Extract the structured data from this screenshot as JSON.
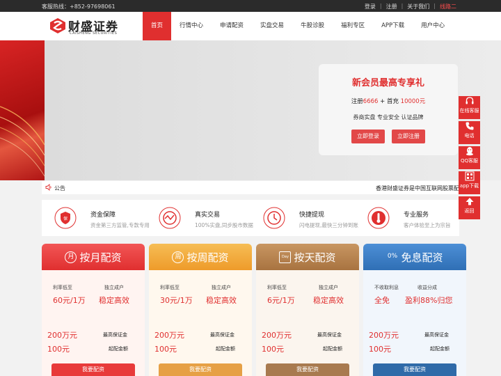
{
  "topbar": {
    "hotline": "客服热线：+852-97698061",
    "links": [
      "登录",
      "注册",
      "关于我们"
    ],
    "route": "线路二"
  },
  "logo": {
    "cn": "财盛证券",
    "en": "CAISHENG SECURITIES"
  },
  "nav": [
    "首页",
    "行情中心",
    "申请配资",
    "实盘交易",
    "牛股诊股",
    "福利专区",
    "APP下载",
    "用户中心"
  ],
  "promo": {
    "title": "新会员最高专享礼",
    "reg_prefix": "注册",
    "reg_amount": "6666",
    "plus": " + 首充 ",
    "charge_amount": "10000元",
    "tagline": "券商实盘 专业安全 认证品牌",
    "login": "立即登录",
    "register": "立即注册"
  },
  "notice": {
    "label": "公告",
    "text": "香港财盛证券是中国互联网股票配"
  },
  "features": [
    {
      "title": "资金保障",
      "desc": "资金第三方监管,专款专用"
    },
    {
      "title": "真实交易",
      "desc": "100%实盘,同步股市数据"
    },
    {
      "title": "快捷提现",
      "desc": "闪电提现,最快三分钟到账"
    },
    {
      "title": "专业服务",
      "desc": "客户体验至上为宗旨"
    }
  ],
  "cards": [
    {
      "badge": "月",
      "title": "按月配资",
      "l1": "利率低至",
      "v1": "60元/1万",
      "l2": "独立成户",
      "v2": "稳定高效",
      "amt1": "200万元",
      "n1": "最高保证金",
      "amt2": "100元",
      "n2": "起配金额",
      "cta": "我要配资",
      "color": "#e83a3a"
    },
    {
      "badge": "周",
      "title": "按周配资",
      "l1": "利率低至",
      "v1": "30元/1万",
      "l2": "独立成户",
      "v2": "稳定高效",
      "amt1": "200万元",
      "n1": "最高保证金",
      "amt2": "100元",
      "n2": "起配金额",
      "cta": "我要配资",
      "color": "#f1a53a"
    },
    {
      "badge": "Day",
      "title": "按天配资",
      "l1": "利率低至",
      "v1": "6元/1万",
      "l2": "独立成户",
      "v2": "稳定高效",
      "amt1": "200万元",
      "n1": "最高保证金",
      "amt2": "100元",
      "n2": "起配金额",
      "cta": "我要配资",
      "color": "#b07b45"
    },
    {
      "badge": "0%",
      "title": "免息配资",
      "l1": "不收取利息",
      "v1": "全免",
      "l2": "收益分成",
      "v2": "盈利88%归您",
      "amt1": "200万元",
      "n1": "最高保证金",
      "amt2": "100元",
      "n2": "起配金额",
      "cta": "我要配资",
      "color": "#3f7fc4"
    }
  ],
  "sidebar": [
    "在线客服",
    "电话",
    "QQ客服",
    "app下载",
    "返回"
  ]
}
